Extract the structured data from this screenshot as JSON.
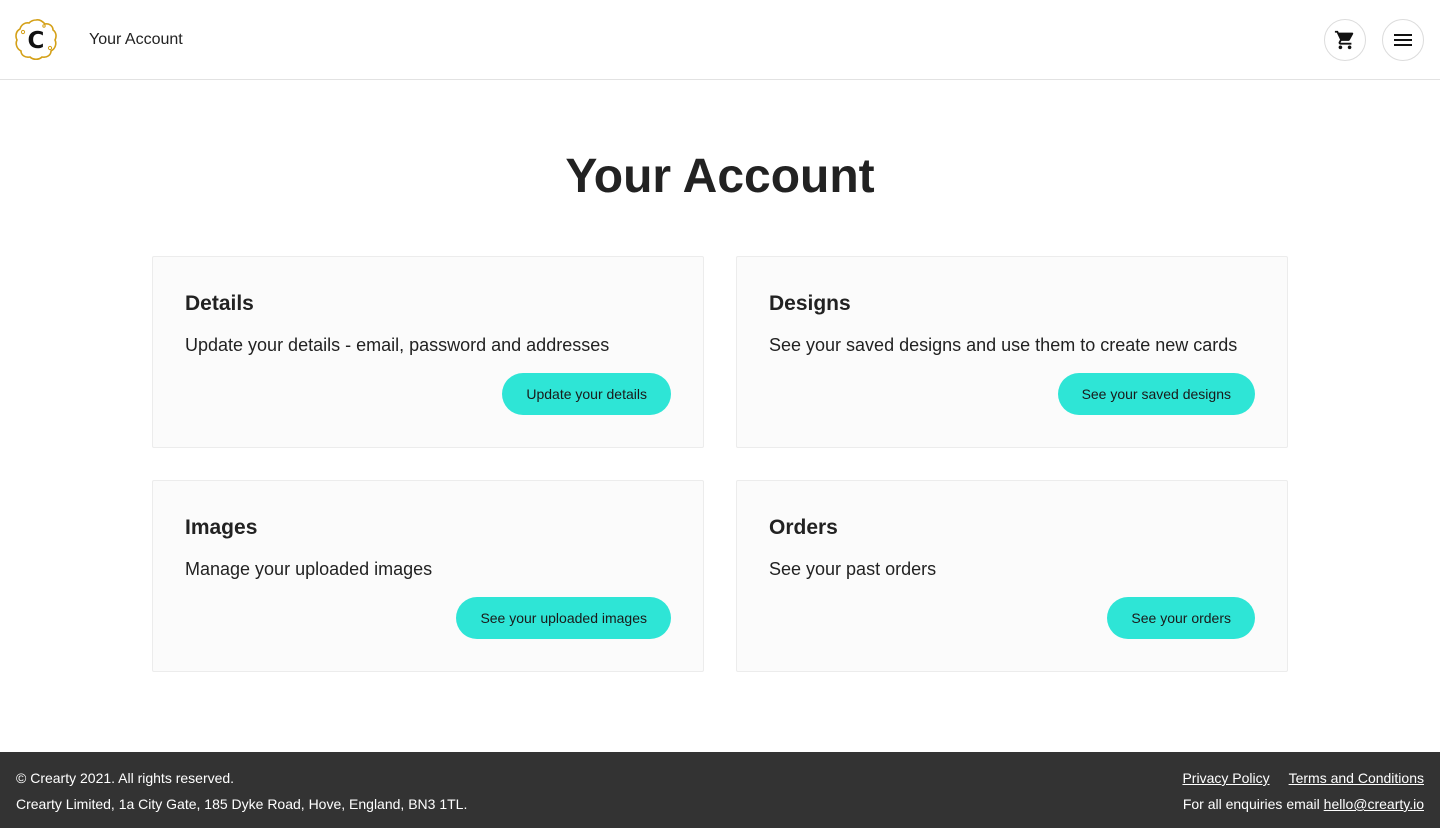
{
  "header": {
    "title": "Your Account",
    "logo_letter": "C",
    "cart_icon": "cart-icon",
    "menu_icon": "hamburger-menu-icon"
  },
  "main": {
    "title": "Your Account",
    "cards": [
      {
        "title": "Details",
        "description": "Update your details - email, password and addresses",
        "button": "Update your details"
      },
      {
        "title": "Designs",
        "description": "See your saved designs and use them to create new cards",
        "button": "See your saved designs"
      },
      {
        "title": "Images",
        "description": "Manage your uploaded images",
        "button": "See your uploaded images"
      },
      {
        "title": "Orders",
        "description": "See your past orders",
        "button": "See your orders"
      }
    ]
  },
  "footer": {
    "copyright": "© Crearty 2021. All rights reserved.",
    "address": "Crearty Limited, 1a City Gate, 185 Dyke Road, Hove, England, BN3 1TL.",
    "links": [
      "Privacy Policy",
      "Terms and Conditions"
    ],
    "enquiries_label": "For all enquiries email",
    "email": "hello@crearty.io"
  },
  "colors": {
    "accent": "#2ee5d6",
    "footer_bg": "#333333",
    "card_bg": "#fbfbfb",
    "logo_gold": "#d4a017"
  }
}
